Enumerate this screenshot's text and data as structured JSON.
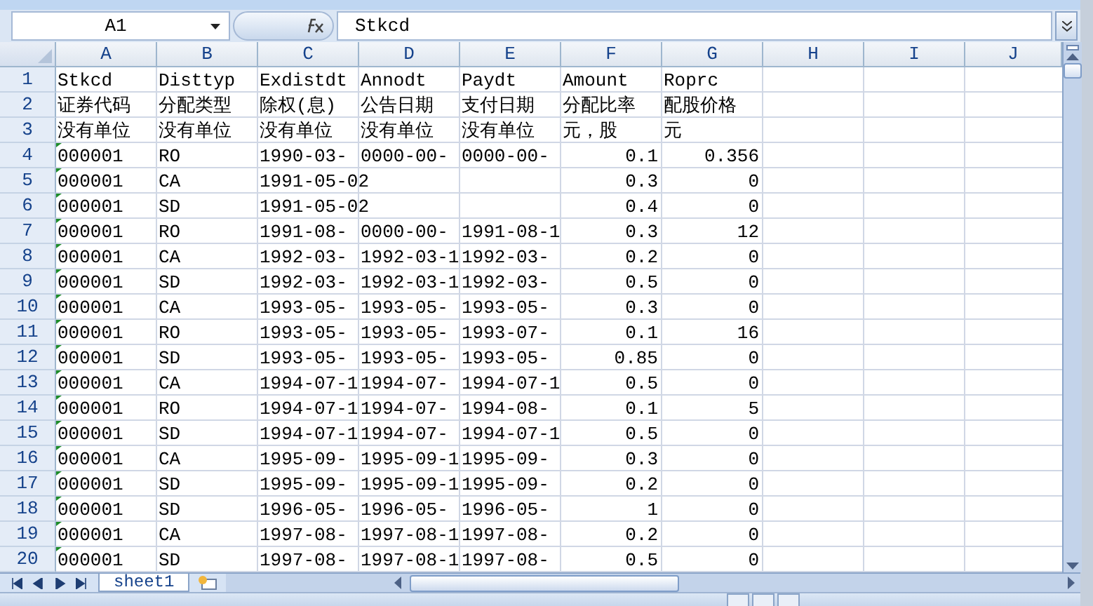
{
  "name_box": {
    "value": "A1"
  },
  "formula_bar": {
    "value": "Stkcd"
  },
  "columns": [
    {
      "label": "A",
      "kind": "text"
    },
    {
      "label": "B",
      "kind": "text"
    },
    {
      "label": "C",
      "kind": "text"
    },
    {
      "label": "D",
      "kind": "text"
    },
    {
      "label": "E",
      "kind": "text"
    },
    {
      "label": "F",
      "kind": "number"
    },
    {
      "label": "G",
      "kind": "number"
    },
    {
      "label": "H",
      "kind": "text"
    },
    {
      "label": "I",
      "kind": "text"
    },
    {
      "label": "J",
      "kind": "text"
    }
  ],
  "rows": [
    {
      "number": "1",
      "kind": "header",
      "number_as_text": false,
      "cells": [
        "Stkcd",
        "Disttyp",
        "Exdistdt",
        "Annodt",
        "Paydt",
        "Amount",
        "Roprc"
      ]
    },
    {
      "number": "2",
      "kind": "header",
      "number_as_text": false,
      "cells": [
        "证券代码",
        "分配类型",
        "除权(息)",
        "公告日期",
        "支付日期",
        "分配比率",
        "配股价格"
      ]
    },
    {
      "number": "3",
      "kind": "header",
      "number_as_text": false,
      "cells": [
        "没有单位",
        "没有单位",
        "没有单位",
        "没有单位",
        "没有单位",
        "元，股",
        "元"
      ]
    },
    {
      "number": "4",
      "kind": "data",
      "number_as_text": true,
      "cells": [
        "000001",
        "RO",
        "1990-03-",
        "0000-00-",
        "0000-00-",
        "0.1",
        "0.356"
      ]
    },
    {
      "number": "5",
      "kind": "data",
      "number_as_text": true,
      "cells": [
        "000001",
        "CA",
        "1991-05-02",
        null,
        null,
        "0.3",
        "0"
      ]
    },
    {
      "number": "6",
      "kind": "data",
      "number_as_text": true,
      "cells": [
        "000001",
        "SD",
        "1991-05-02",
        null,
        null,
        "0.4",
        "0"
      ]
    },
    {
      "number": "7",
      "kind": "data",
      "number_as_text": true,
      "cells": [
        "000001",
        "RO",
        "1991-08-",
        "0000-00-",
        "1991-08-1",
        "0.3",
        "12"
      ]
    },
    {
      "number": "8",
      "kind": "data",
      "number_as_text": true,
      "cells": [
        "000001",
        "CA",
        "1992-03-",
        "1992-03-1",
        "1992-03-",
        "0.2",
        "0"
      ]
    },
    {
      "number": "9",
      "kind": "data",
      "number_as_text": true,
      "cells": [
        "000001",
        "SD",
        "1992-03-",
        "1992-03-1",
        "1992-03-",
        "0.5",
        "0"
      ]
    },
    {
      "number": "10",
      "kind": "data",
      "number_as_text": true,
      "cells": [
        "000001",
        "CA",
        "1993-05-",
        "1993-05-",
        "1993-05-",
        "0.3",
        "0"
      ]
    },
    {
      "number": "11",
      "kind": "data",
      "number_as_text": true,
      "cells": [
        "000001",
        "RO",
        "1993-05-",
        "1993-05-",
        "1993-07-",
        "0.1",
        "16"
      ]
    },
    {
      "number": "12",
      "kind": "data",
      "number_as_text": true,
      "cells": [
        "000001",
        "SD",
        "1993-05-",
        "1993-05-",
        "1993-05-",
        "0.85",
        "0"
      ]
    },
    {
      "number": "13",
      "kind": "data",
      "number_as_text": true,
      "cells": [
        "000001",
        "CA",
        "1994-07-1",
        "1994-07-",
        "1994-07-1",
        "0.5",
        "0"
      ]
    },
    {
      "number": "14",
      "kind": "data",
      "number_as_text": true,
      "cells": [
        "000001",
        "RO",
        "1994-07-1",
        "1994-07-",
        "1994-08-",
        "0.1",
        "5"
      ]
    },
    {
      "number": "15",
      "kind": "data",
      "number_as_text": true,
      "cells": [
        "000001",
        "SD",
        "1994-07-1",
        "1994-07-",
        "1994-07-1",
        "0.5",
        "0"
      ]
    },
    {
      "number": "16",
      "kind": "data",
      "number_as_text": true,
      "cells": [
        "000001",
        "CA",
        "1995-09-",
        "1995-09-1",
        "1995-09-",
        "0.3",
        "0"
      ]
    },
    {
      "number": "17",
      "kind": "data",
      "number_as_text": true,
      "cells": [
        "000001",
        "SD",
        "1995-09-",
        "1995-09-1",
        "1995-09-",
        "0.2",
        "0"
      ]
    },
    {
      "number": "18",
      "kind": "data",
      "number_as_text": true,
      "cells": [
        "000001",
        "SD",
        "1996-05-",
        "1996-05-",
        "1996-05-",
        "1",
        "0"
      ]
    },
    {
      "number": "19",
      "kind": "data",
      "number_as_text": true,
      "cells": [
        "000001",
        "CA",
        "1997-08-",
        "1997-08-1",
        "1997-08-",
        "0.2",
        "0"
      ]
    },
    {
      "number": "20",
      "kind": "data",
      "number_as_text": true,
      "cells": [
        "000001",
        "SD",
        "1997-08-",
        "1997-08-1",
        "1997-08-",
        "0.5",
        "0"
      ]
    }
  ],
  "sheet_tabs": [
    {
      "label": "sheet1",
      "selected": true
    }
  ]
}
